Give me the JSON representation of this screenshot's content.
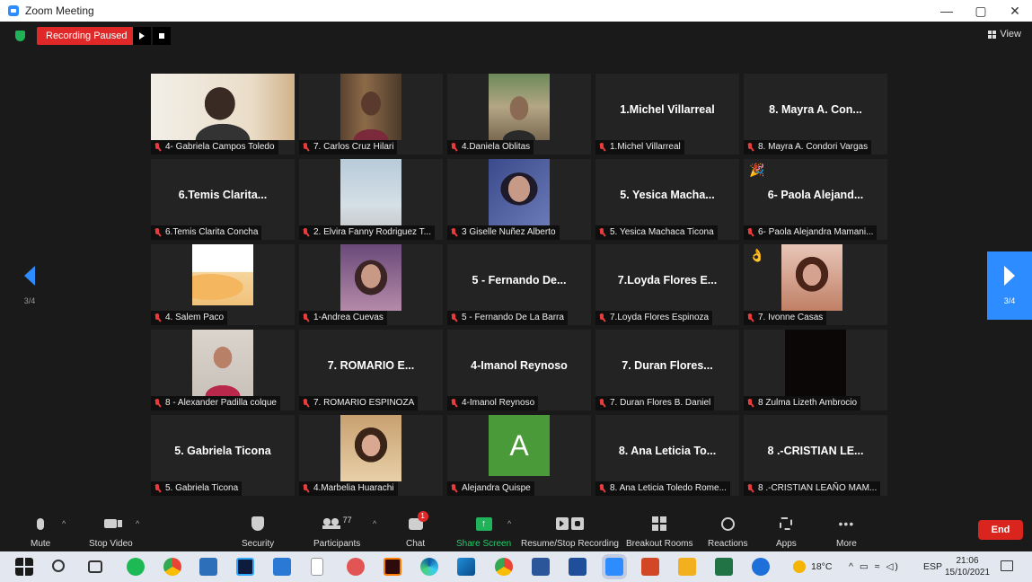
{
  "window": {
    "title": "Zoom Meeting",
    "minimize": "—",
    "maximize": "▢",
    "close": "✕"
  },
  "topbar": {
    "recording_status": "Recording Paused",
    "view_label": "View"
  },
  "pager": {
    "left_page": "3/4",
    "right_page": "3/4"
  },
  "tiles": [
    {
      "display": "",
      "label": "4- Gabriela Campos Toledo",
      "video": "v-gabriela"
    },
    {
      "display": "",
      "label": "7. Carlos Cruz Hilari",
      "video": "v-carlos"
    },
    {
      "display": "",
      "label": "4.Daniela Oblitas",
      "video": "v-daniela"
    },
    {
      "display": "1.Michel Villarreal",
      "label": "1.Michel Villarreal",
      "video": ""
    },
    {
      "display": "8. Mayra A. Con...",
      "label": "8. Mayra A. Condori Vargas",
      "video": ""
    },
    {
      "display": "6.Temis Clarita...",
      "label": "6.Temis Clarita Concha",
      "video": ""
    },
    {
      "display": "",
      "label": "2. Elvira Fanny Rodriguez T...",
      "video": "v-elvira"
    },
    {
      "display": "",
      "label": "3 Giselle Nuñez Alberto",
      "video": "v-giselle"
    },
    {
      "display": "5. Yesica Macha...",
      "label": "5. Yesica Machaca Ticona",
      "video": ""
    },
    {
      "display": "6- Paola Alejand...",
      "label": "6- Paola Alejandra Mamani...",
      "video": "",
      "reaction": "🎉"
    },
    {
      "display": "",
      "label": "4. Salem Paco",
      "video": "v-salem"
    },
    {
      "display": "",
      "label": "1-Andrea Cuevas",
      "video": "v-andrea"
    },
    {
      "display": "5 - Fernando De...",
      "label": "5 - Fernando De La Barra",
      "video": ""
    },
    {
      "display": "7.Loyda Flores E...",
      "label": "7.Loyda Flores Espinoza",
      "video": ""
    },
    {
      "display": "",
      "label": "7. Ivonne Casas",
      "video": "v-ivonne",
      "reaction": "👌"
    },
    {
      "display": "",
      "label": "8 - Alexander Padilla colque",
      "video": "v-alexander"
    },
    {
      "display": "7.    ROMARIO E...",
      "label": "7.    ROMARIO ESPINOZA",
      "video": ""
    },
    {
      "display": "4-Imanol Reynoso",
      "label": "4-Imanol Reynoso",
      "video": ""
    },
    {
      "display": "7. Duran Flores...",
      "label": "7. Duran Flores B. Daniel",
      "video": ""
    },
    {
      "display": "",
      "label": "8 Zulma Lizeth Ambrocio",
      "video": "v-zulma"
    },
    {
      "display": "5. Gabriela Ticona",
      "label": "5. Gabriela Ticona",
      "video": ""
    },
    {
      "display": "",
      "label": "4.Marbelia Huarachi",
      "video": "v-marbelia"
    },
    {
      "display": "",
      "label": "Alejandra Quispe",
      "video": "v-avatar",
      "avatar_letter": "A"
    },
    {
      "display": "8. Ana Leticia To...",
      "label": "8. Ana Leticia Toledo Rome...",
      "video": ""
    },
    {
      "display": "8 .-CRISTIAN LE...",
      "label": "8 .-CRISTIAN LEAÑO MAM...",
      "video": ""
    }
  ],
  "toolbar": {
    "mute": "Mute",
    "stop_video": "Stop Video",
    "security": "Security",
    "participants": "Participants",
    "participants_count": "77",
    "chat": "Chat",
    "chat_badge": "1",
    "share_screen": "Share Screen",
    "share_arrow": "↑",
    "recording": "Resume/Stop Recording",
    "breakout": "Breakout Rooms",
    "reactions": "Reactions",
    "apps": "Apps",
    "more": "More",
    "more_dots": "•••",
    "end": "End",
    "caret": "^"
  },
  "taskbar": {
    "weather": "18°C",
    "tray_symbols": "^ ▭ ≈ ◁)",
    "language": "ESP",
    "time": "21:06",
    "date": "15/10/2021"
  },
  "colors": {
    "accent": "#2d8cff",
    "record_red": "#e02828",
    "share_green": "#1fb35a",
    "end_red": "#d9251d"
  }
}
